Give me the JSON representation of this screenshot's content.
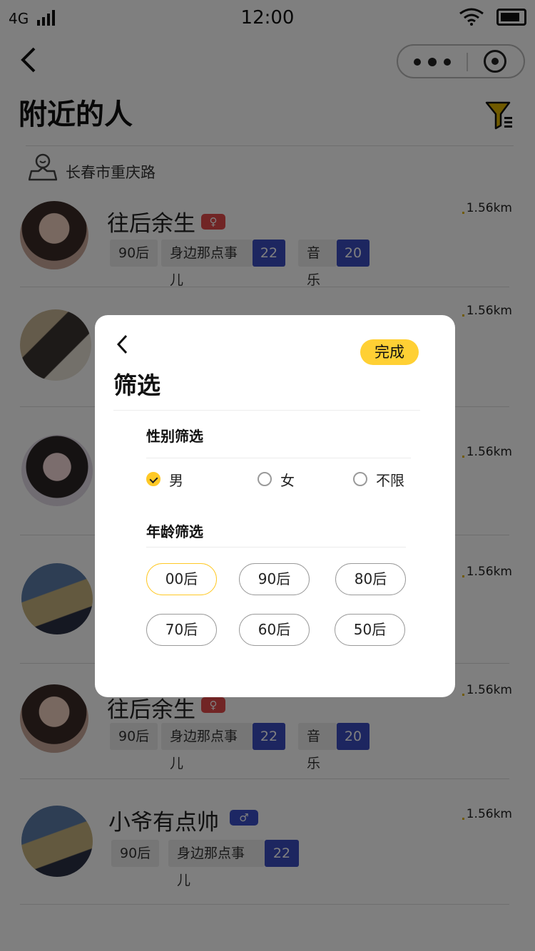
{
  "status": {
    "network": "4G",
    "time": "12:00"
  },
  "header": {
    "title": "附近的人"
  },
  "location": {
    "text": "长春市重庆路"
  },
  "people": [
    {
      "name": "往后余生",
      "gender": "female",
      "tags": [
        {
          "label": "90后"
        },
        {
          "label": "身边那点事儿",
          "count": "22"
        },
        {
          "label": "音乐",
          "count": "20"
        }
      ],
      "distance": "1.56km"
    },
    {
      "name": "",
      "gender": "",
      "tags": [],
      "distance": "1.56km"
    },
    {
      "name": "",
      "gender": "",
      "tags": [],
      "distance": "1.56km"
    },
    {
      "name": "",
      "gender": "",
      "tags": [],
      "distance": "1.56km"
    },
    {
      "name": "往后余生",
      "gender": "female",
      "tags": [
        {
          "label": "90后"
        },
        {
          "label": "身边那点事儿",
          "count": "22"
        },
        {
          "label": "音乐",
          "count": "20"
        }
      ],
      "distance": "1.56km"
    },
    {
      "name": "小爷有点帅",
      "gender": "male",
      "tags": [
        {
          "label": "90后"
        },
        {
          "label": "身边那点事儿",
          "count": "22"
        }
      ],
      "distance": "1.56km"
    }
  ],
  "dialog": {
    "title": "筛选",
    "done_label": "完成",
    "gender_section": {
      "title": "性别筛选",
      "options": [
        "男",
        "女",
        "不限"
      ],
      "selected": "男"
    },
    "age_section": {
      "title": "年龄筛选",
      "options": [
        "00后",
        "90后",
        "80后",
        "70后",
        "60后",
        "50后"
      ],
      "selected": "00后"
    }
  },
  "colors": {
    "accent": "#ffd034",
    "tag_count": "#3b4cc0",
    "female_badge": "#e24a4a",
    "male_badge": "#3a4fc8"
  }
}
